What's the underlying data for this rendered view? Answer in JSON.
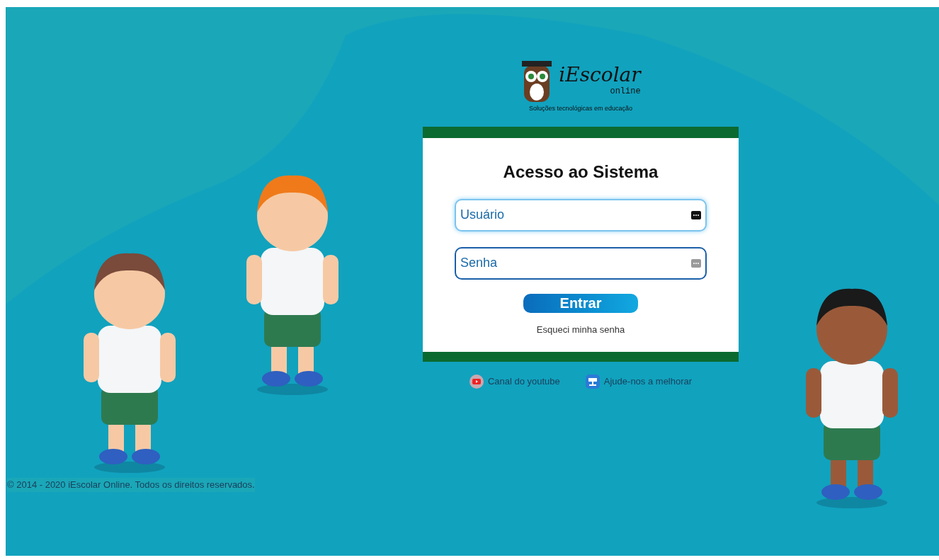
{
  "logo": {
    "name": "iEscolar",
    "suffix": "online",
    "tagline": "Soluções tecnológicas em educação"
  },
  "login": {
    "title": "Acesso ao Sistema",
    "fields": [
      {
        "placeholder": "Usuário",
        "focused": true
      },
      {
        "placeholder": "Senha",
        "focused": false
      }
    ],
    "submit": "Entrar",
    "forgot": "Esqueci minha senha"
  },
  "links": [
    {
      "kind": "video",
      "label": "Canal do youtube"
    },
    {
      "kind": "feedback",
      "label": "Ajude-nos a melhorar"
    }
  ],
  "footer": "© 2014 - 2020 iEscolar Online. Todos os direitos reservados."
}
